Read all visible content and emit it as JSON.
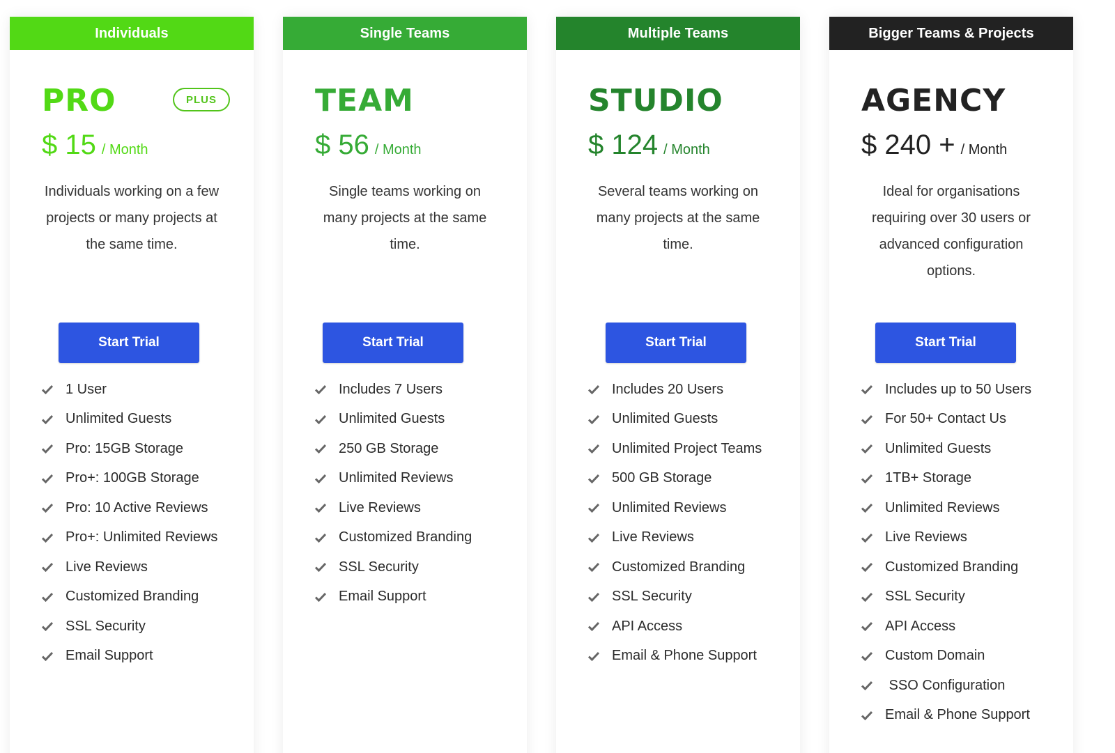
{
  "colors": {
    "individuals": "#52d915",
    "single_teams": "#36ab36",
    "multiple_teams": "#24842c",
    "bigger_teams": "#222222",
    "button": "#2d55e1",
    "check": "#666666"
  },
  "plans": [
    {
      "category": "Individuals",
      "name": "PRO",
      "badge": "PLUS",
      "price": "$ 15",
      "period": "/ Month",
      "description": "Individuals working on a few projects or many projects at the same time.",
      "button_label": "Start Trial",
      "features": [
        "1 User",
        "Unlimited Guests",
        "Pro: 15GB Storage",
        "Pro+: 100GB Storage",
        "Pro: 10 Active Reviews",
        "Pro+: Unlimited Reviews",
        "Live Reviews",
        "Customized Branding",
        "SSL Security",
        "Email Support"
      ]
    },
    {
      "category": "Single Teams",
      "name": "TEAM",
      "price": "$ 56",
      "period": "/ Month",
      "description": "Single teams working on many projects at the same time.",
      "button_label": "Start Trial",
      "features": [
        "Includes 7 Users",
        "Unlimited Guests",
        "250 GB Storage",
        "Unlimited Reviews",
        "Live Reviews",
        "Customized Branding",
        "SSL Security",
        "Email Support"
      ]
    },
    {
      "category": "Multiple Teams",
      "name": "STUDIO",
      "price": "$ 124",
      "period": "/ Month",
      "description": "Several teams working on many projects at the same time.",
      "button_label": "Start Trial",
      "features": [
        "Includes 20 Users",
        "Unlimited Guests",
        "Unlimited Project Teams",
        "500 GB Storage",
        "Unlimited Reviews",
        "Live Reviews",
        "Customized Branding",
        "SSL Security",
        "API Access",
        "Email & Phone Support"
      ]
    },
    {
      "category": "Bigger Teams & Projects",
      "name": "AGENCY",
      "price": "$ 240 +",
      "period": "/ Month",
      "description": "Ideal for organisations requiring over 30 users or advanced configuration options.",
      "button_label": "Start Trial",
      "features": [
        "Includes up to 50 Users",
        "For 50+ Contact Us",
        "Unlimited Guests",
        "1TB+ Storage",
        "Unlimited Reviews",
        "Live Reviews",
        "Customized Branding",
        "SSL Security",
        "API Access",
        "Custom Domain",
        " SSO Configuration",
        "Email & Phone Support"
      ]
    }
  ]
}
